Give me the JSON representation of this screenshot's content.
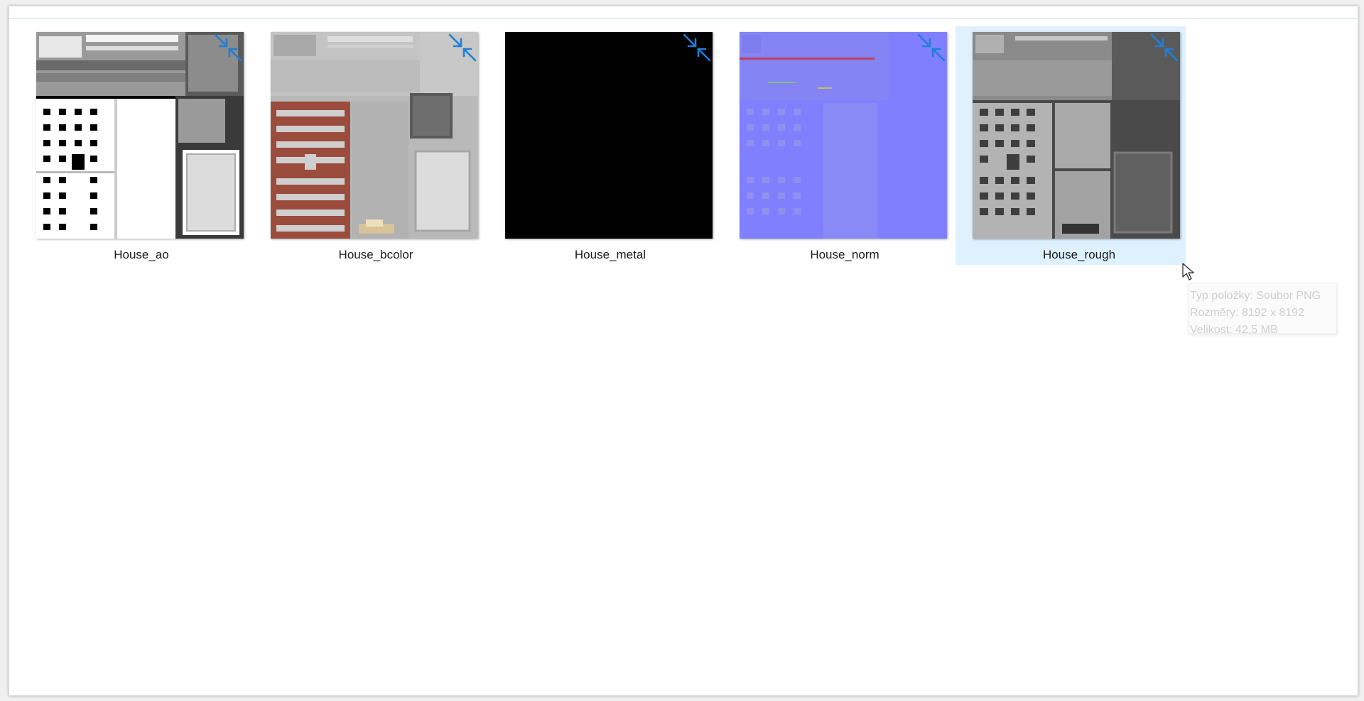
{
  "files": [
    {
      "name": "House_ao",
      "selected": false,
      "style": "ao"
    },
    {
      "name": "House_bcolor",
      "selected": false,
      "style": "bcolor"
    },
    {
      "name": "House_metal",
      "selected": false,
      "style": "metal"
    },
    {
      "name": "House_norm",
      "selected": false,
      "style": "norm"
    },
    {
      "name": "House_rough",
      "selected": true,
      "style": "rough"
    }
  ],
  "tooltip": {
    "type_line": "Typ položky: Soubor PNG",
    "dimensions_line": "Rozměry: 8192 x 8192",
    "size_line": "Velikost: 42,5 MB"
  },
  "colors": {
    "selection": "#cce8ff",
    "compress_icon": "#1f7fd6",
    "bcolor_brick": "#9b4c3c",
    "norm_blue": "#8080fe"
  },
  "icons": {
    "compressed_overlay": "compress-arrows-icon",
    "pointer": "mouse-cursor-icon"
  }
}
